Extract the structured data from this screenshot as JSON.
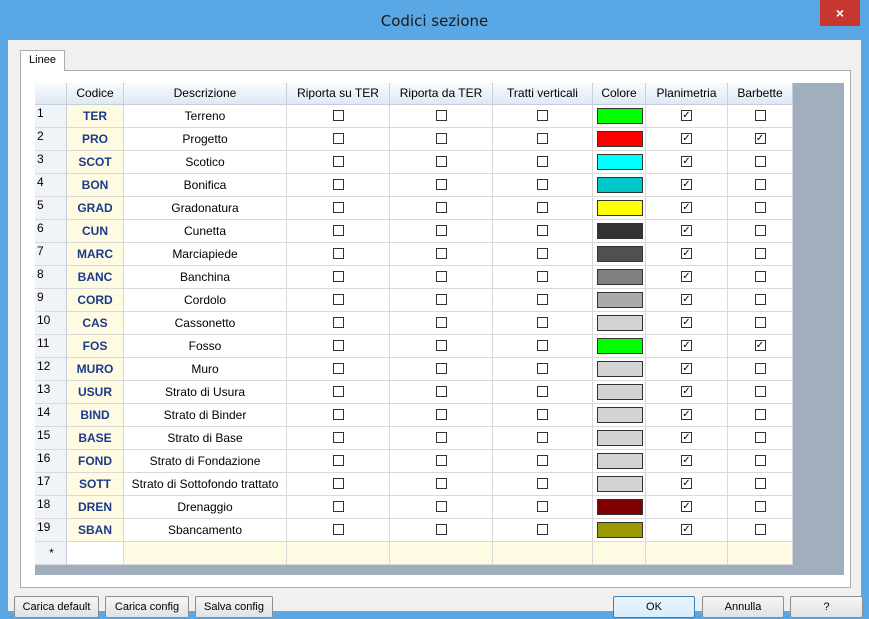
{
  "window": {
    "title": "Codici sezione",
    "close_symbol": "×"
  },
  "tabs": [
    {
      "label": "Linee"
    }
  ],
  "columns": [
    "Codice",
    "Descrizione",
    "Riporta su TER",
    "Riporta da TER",
    "Tratti verticali",
    "Colore",
    "Planimetria",
    "Barbette"
  ],
  "rows": [
    {
      "num": "1",
      "code": "TER",
      "desc": "Terreno",
      "riporta_su": false,
      "riporta_da": false,
      "tratti": false,
      "color": "#00ff00",
      "plan": true,
      "barb": false
    },
    {
      "num": "2",
      "code": "PRO",
      "desc": "Progetto",
      "riporta_su": false,
      "riporta_da": false,
      "tratti": false,
      "color": "#ff0000",
      "plan": true,
      "barb": true
    },
    {
      "num": "3",
      "code": "SCOT",
      "desc": "Scotico",
      "riporta_su": false,
      "riporta_da": false,
      "tratti": false,
      "color": "#00ffff",
      "plan": true,
      "barb": false
    },
    {
      "num": "4",
      "code": "BON",
      "desc": "Bonifica",
      "riporta_su": false,
      "riporta_da": false,
      "tratti": false,
      "color": "#00c8c8",
      "plan": true,
      "barb": false
    },
    {
      "num": "5",
      "code": "GRAD",
      "desc": "Gradonatura",
      "riporta_su": false,
      "riporta_da": false,
      "tratti": false,
      "color": "#ffff00",
      "plan": true,
      "barb": false
    },
    {
      "num": "6",
      "code": "CUN",
      "desc": "Cunetta",
      "riporta_su": false,
      "riporta_da": false,
      "tratti": false,
      "color": "#333333",
      "plan": true,
      "barb": false
    },
    {
      "num": "7",
      "code": "MARC",
      "desc": "Marciapiede",
      "riporta_su": false,
      "riporta_da": false,
      "tratti": false,
      "color": "#505050",
      "plan": true,
      "barb": false
    },
    {
      "num": "8",
      "code": "BANC",
      "desc": "Banchina",
      "riporta_su": false,
      "riporta_da": false,
      "tratti": false,
      "color": "#808080",
      "plan": true,
      "barb": false
    },
    {
      "num": "9",
      "code": "CORD",
      "desc": "Cordolo",
      "riporta_su": false,
      "riporta_da": false,
      "tratti": false,
      "color": "#a9a9a9",
      "plan": true,
      "barb": false
    },
    {
      "num": "10",
      "code": "CAS",
      "desc": "Cassonetto",
      "riporta_su": false,
      "riporta_da": false,
      "tratti": false,
      "color": "#d3d3d3",
      "plan": true,
      "barb": false
    },
    {
      "num": "11",
      "code": "FOS",
      "desc": "Fosso",
      "riporta_su": false,
      "riporta_da": false,
      "tratti": false,
      "color": "#00ff00",
      "plan": true,
      "barb": true
    },
    {
      "num": "12",
      "code": "MURO",
      "desc": "Muro",
      "riporta_su": false,
      "riporta_da": false,
      "tratti": false,
      "color": "#d3d3d3",
      "plan": true,
      "barb": false
    },
    {
      "num": "13",
      "code": "USUR",
      "desc": "Strato di Usura",
      "riporta_su": false,
      "riporta_da": false,
      "tratti": false,
      "color": "#d3d3d3",
      "plan": true,
      "barb": false
    },
    {
      "num": "14",
      "code": "BIND",
      "desc": "Strato di Binder",
      "riporta_su": false,
      "riporta_da": false,
      "tratti": false,
      "color": "#d3d3d3",
      "plan": true,
      "barb": false
    },
    {
      "num": "15",
      "code": "BASE",
      "desc": "Strato di Base",
      "riporta_su": false,
      "riporta_da": false,
      "tratti": false,
      "color": "#d3d3d3",
      "plan": true,
      "barb": false
    },
    {
      "num": "16",
      "code": "FOND",
      "desc": "Strato di Fondazione",
      "riporta_su": false,
      "riporta_da": false,
      "tratti": false,
      "color": "#d3d3d3",
      "plan": true,
      "barb": false
    },
    {
      "num": "17",
      "code": "SOTT",
      "desc": "Strato di Sottofondo trattato",
      "riporta_su": false,
      "riporta_da": false,
      "tratti": false,
      "color": "#d3d3d3",
      "plan": true,
      "barb": false
    },
    {
      "num": "18",
      "code": "DREN",
      "desc": "Drenaggio",
      "riporta_su": false,
      "riporta_da": false,
      "tratti": false,
      "color": "#800000",
      "plan": true,
      "barb": false
    },
    {
      "num": "19",
      "code": "SBAN",
      "desc": "Sbancamento",
      "riporta_su": false,
      "riporta_da": false,
      "tratti": false,
      "color": "#9a9a00",
      "plan": true,
      "barb": false
    }
  ],
  "new_row_marker": "*",
  "buttons": {
    "carica_default": "Carica default",
    "carica_config": "Carica config",
    "salva_config": "Salva config",
    "ok": "OK",
    "annulla": "Annulla",
    "help": "?"
  }
}
